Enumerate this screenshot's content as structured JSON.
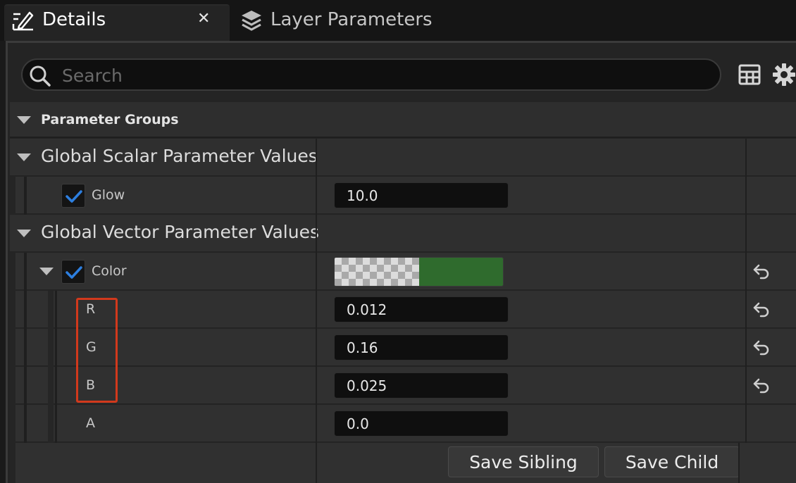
{
  "tabs": [
    {
      "label": "Details",
      "icon": "edit-pencil-icon",
      "close_glyph": "✕"
    },
    {
      "label": "Layer Parameters",
      "icon": "layers-icon"
    }
  ],
  "search": {
    "placeholder": "Search",
    "value": ""
  },
  "toolbar": {
    "table_icon": "table-view-icon",
    "settings_icon": "gear-icon"
  },
  "parameter_groups_label": "Parameter Groups",
  "scalar_section": {
    "title": "Global Scalar Parameter Values",
    "params": [
      {
        "name": "Glow",
        "value": "10.0",
        "checked": true
      }
    ]
  },
  "vector_section": {
    "title": "Global Vector Parameter Values",
    "param": {
      "name": "Color",
      "checked": true,
      "swatch_color": "#2f6b2d",
      "channels": [
        {
          "name": "R",
          "value": "0.012",
          "has_reset": true
        },
        {
          "name": "G",
          "value": "0.16",
          "has_reset": true
        },
        {
          "name": "B",
          "value": "0.025",
          "has_reset": true
        },
        {
          "name": "A",
          "value": "0.0",
          "has_reset": false
        }
      ]
    }
  },
  "buttons": {
    "save_sibling": "Save Sibling",
    "save_child": "Save Child"
  },
  "colors": {
    "accent_check": "#2d7fe0",
    "highlight": "#d2391c"
  }
}
